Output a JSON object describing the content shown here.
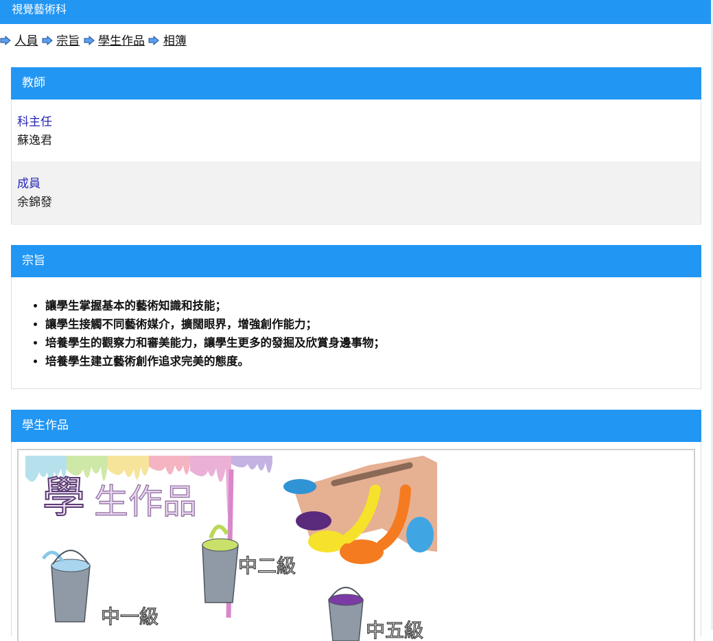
{
  "header": {
    "title": "視覺藝術科"
  },
  "breadcrumb": {
    "items": [
      "人員",
      "宗旨",
      "學生作品",
      "相簿"
    ]
  },
  "teachers": {
    "title": "教師",
    "members": [
      {
        "role": "科主任",
        "name": "蘇逸君"
      },
      {
        "role": "成員",
        "name": "余錦發"
      }
    ]
  },
  "aims": {
    "title": "宗旨",
    "items": [
      "讓學生掌握基本的藝術知識和技能；",
      "讓學生接觸不同藝術媒介，擴闊眼界，增強創作能力；",
      "培養學生的觀察力和審美能力，讓學生更多的發掘及欣賞身邊事物；",
      "培養學生建立藝術創作追求完美的態度。"
    ]
  },
  "works": {
    "title": "學生作品",
    "poster": {
      "heading": "學生作品",
      "grades": [
        "中一級",
        "中二級",
        "中五級"
      ]
    }
  },
  "colors": {
    "accent": "#2196f3",
    "role_text": "#2525b8",
    "alt_row": "#f2f2f2"
  }
}
